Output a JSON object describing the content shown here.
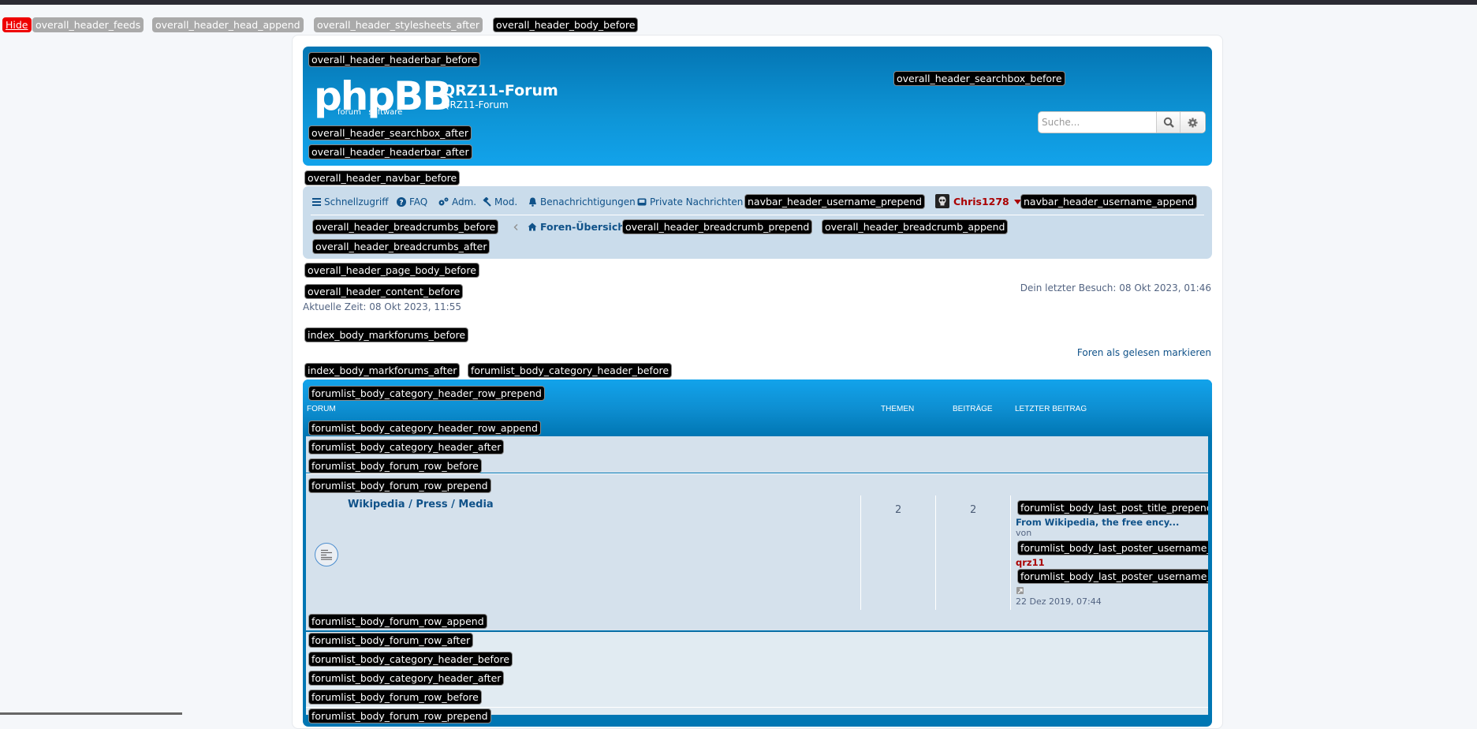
{
  "debug_events": {
    "hide": "Hide",
    "top": [
      "overall_header_feeds",
      "overall_header_head_append",
      "overall_header_stylesheets_after",
      "overall_header_body_before"
    ],
    "headerbar_before": "overall_header_headerbar_before",
    "searchbox_before": "overall_header_searchbox_before",
    "searchbox_after": "overall_header_searchbox_after",
    "headerbar_after": "overall_header_headerbar_after",
    "navbar_before": "overall_header_navbar_before",
    "username_prepend": "navbar_header_username_prepend",
    "username_append": "navbar_header_username_append",
    "breadcrumbs_before": "overall_header_breadcrumbs_before",
    "breadcrumb_prepend": "overall_header_breadcrumb_prepend",
    "breadcrumb_append": "overall_header_breadcrumb_append",
    "breadcrumbs_after": "overall_header_breadcrumbs_after",
    "page_body_before": "overall_header_page_body_before",
    "content_before": "overall_header_content_before",
    "markforums_before": "index_body_markforums_before",
    "markforums_after": "index_body_markforums_after",
    "category_header_before": "forumlist_body_category_header_before",
    "category_header_row_prepend": "forumlist_body_category_header_row_prepend",
    "category_header_row_append": "forumlist_body_category_header_row_append",
    "category_header_after": "forumlist_body_category_header_after",
    "forum_row_before": "forumlist_body_forum_row_before",
    "forum_row_prepend": "forumlist_body_forum_row_prepend",
    "last_post_title_prepend": "forumlist_body_last_post_title_prepend",
    "last_poster_username_prepend": "forumlist_body_last_poster_username_prepend",
    "last_poster_username_append": "forumlist_body_last_poster_username_append",
    "forum_row_append": "forumlist_body_forum_row_append",
    "forum_row_after": "forumlist_body_forum_row_after",
    "category_header_before_2": "forumlist_body_category_header_before",
    "category_header_after_2": "forumlist_body_category_header_after",
    "forum_row_before_2": "forumlist_body_forum_row_before",
    "forum_row_prepend_2": "forumlist_body_forum_row_prepend"
  },
  "header": {
    "logo_text": "phpBB",
    "logo_sub_left": "forum",
    "logo_sub_right": "software",
    "site_title": "QRZ11-Forum",
    "site_description": "QRZ11-Forum",
    "search_placeholder": "Suche..."
  },
  "navbar": {
    "quick_links": "Schnellzugriff",
    "faq": "FAQ",
    "acp": "Adm.",
    "mcp": "Mod.",
    "notifications": "Benachrichtigungen",
    "private_messages": "Private Nachrichten",
    "username": "Chris1278",
    "breadcrumb_home": "Foren-Übersicht"
  },
  "page": {
    "last_visit": "Dein letzter Besuch: 08 Okt 2023, 01:46",
    "current_time": "Aktuelle Zeit: 08 Okt 2023, 11:55",
    "mark_read": "Foren als gelesen markieren"
  },
  "forumlist": {
    "columns": {
      "forum": "FORUM",
      "topics": "THEMEN",
      "posts": "BEITRÄGE",
      "last_post": "LETZTER BEITRAG"
    },
    "forums": [
      {
        "title": "Wikipedia / Press / Media",
        "topics": "2",
        "posts": "2",
        "last_post_title": "From Wikipedia, the free ency...",
        "by_label": "von",
        "last_poster": "qrz11",
        "last_post_time": "22 Dez 2019, 07:44"
      }
    ]
  },
  "colors": {
    "header_blue": "#0e95d7",
    "navbar_bg": "#cadceb",
    "link": "#105289",
    "username_red": "#aa0000",
    "row_bg": "#d5e1ec"
  }
}
